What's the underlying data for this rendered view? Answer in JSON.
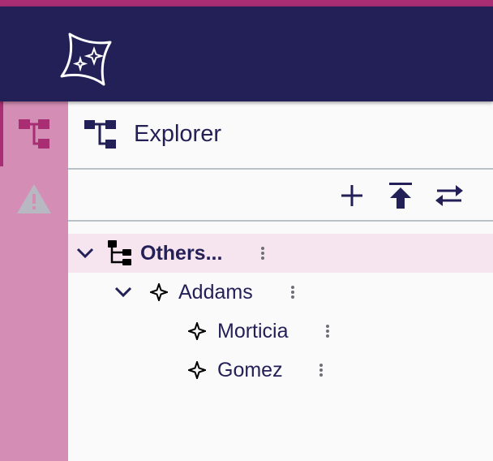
{
  "header": {
    "logo": "sparkle-star-logo",
    "accent": "#a82d72",
    "background": "#231f57"
  },
  "rail": {
    "items": [
      {
        "icon": "tree-structure-icon",
        "active": true
      },
      {
        "icon": "warning-icon",
        "active": false
      }
    ]
  },
  "explorer": {
    "title": "Explorer",
    "title_icon": "tree-structure-icon",
    "toolbar": [
      {
        "icon": "plus-icon"
      },
      {
        "icon": "upload-to-top-icon"
      },
      {
        "icon": "swap-arrows-icon"
      }
    ],
    "tree": [
      {
        "label": "Others...",
        "icon": "tree-structure-icon",
        "expanded": true,
        "selected": true,
        "level": 0
      },
      {
        "label": "Addams",
        "icon": "sparkle-icon",
        "expanded": true,
        "selected": false,
        "level": 1
      },
      {
        "label": "Morticia",
        "icon": "sparkle-icon",
        "selected": false,
        "level": 2
      },
      {
        "label": "Gomez",
        "icon": "sparkle-icon",
        "selected": false,
        "level": 2
      }
    ]
  }
}
